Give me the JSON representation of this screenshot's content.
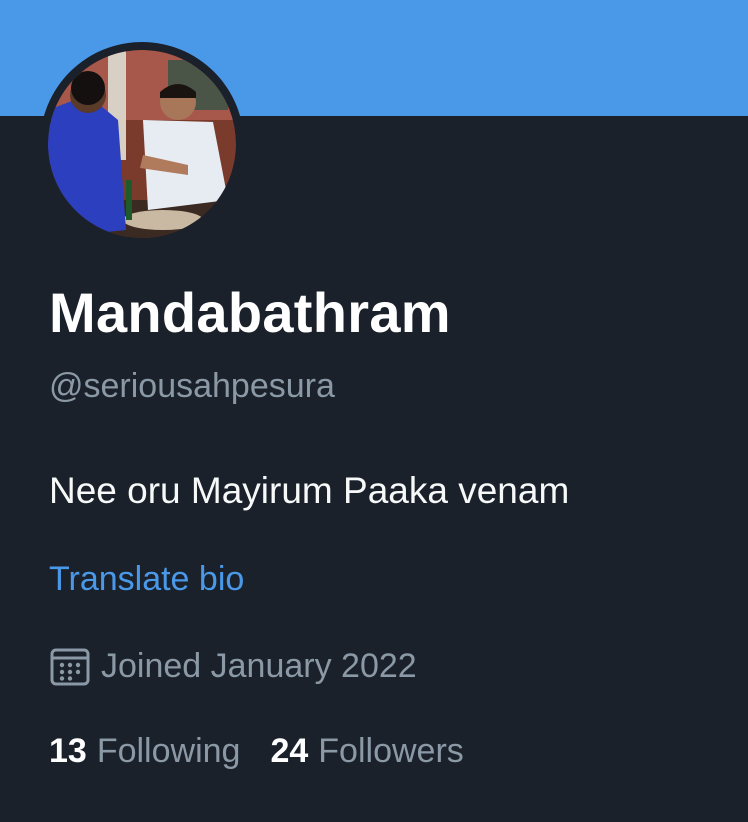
{
  "profile": {
    "display_name": "Mandabathram",
    "handle": "@seriousahpesura",
    "bio": "Nee oru Mayirum Paaka venam",
    "translate_label": "Translate bio",
    "joined": "Joined January 2022",
    "following_count": "13",
    "following_label": "Following",
    "followers_count": "24",
    "followers_label": "Followers",
    "joined_icon": "calendar-icon"
  },
  "colors": {
    "banner": "#4a99e9",
    "background": "#1a212b",
    "primary_text": "#ffffff",
    "secondary_text": "#8b98a5",
    "link": "#4a99e9"
  }
}
